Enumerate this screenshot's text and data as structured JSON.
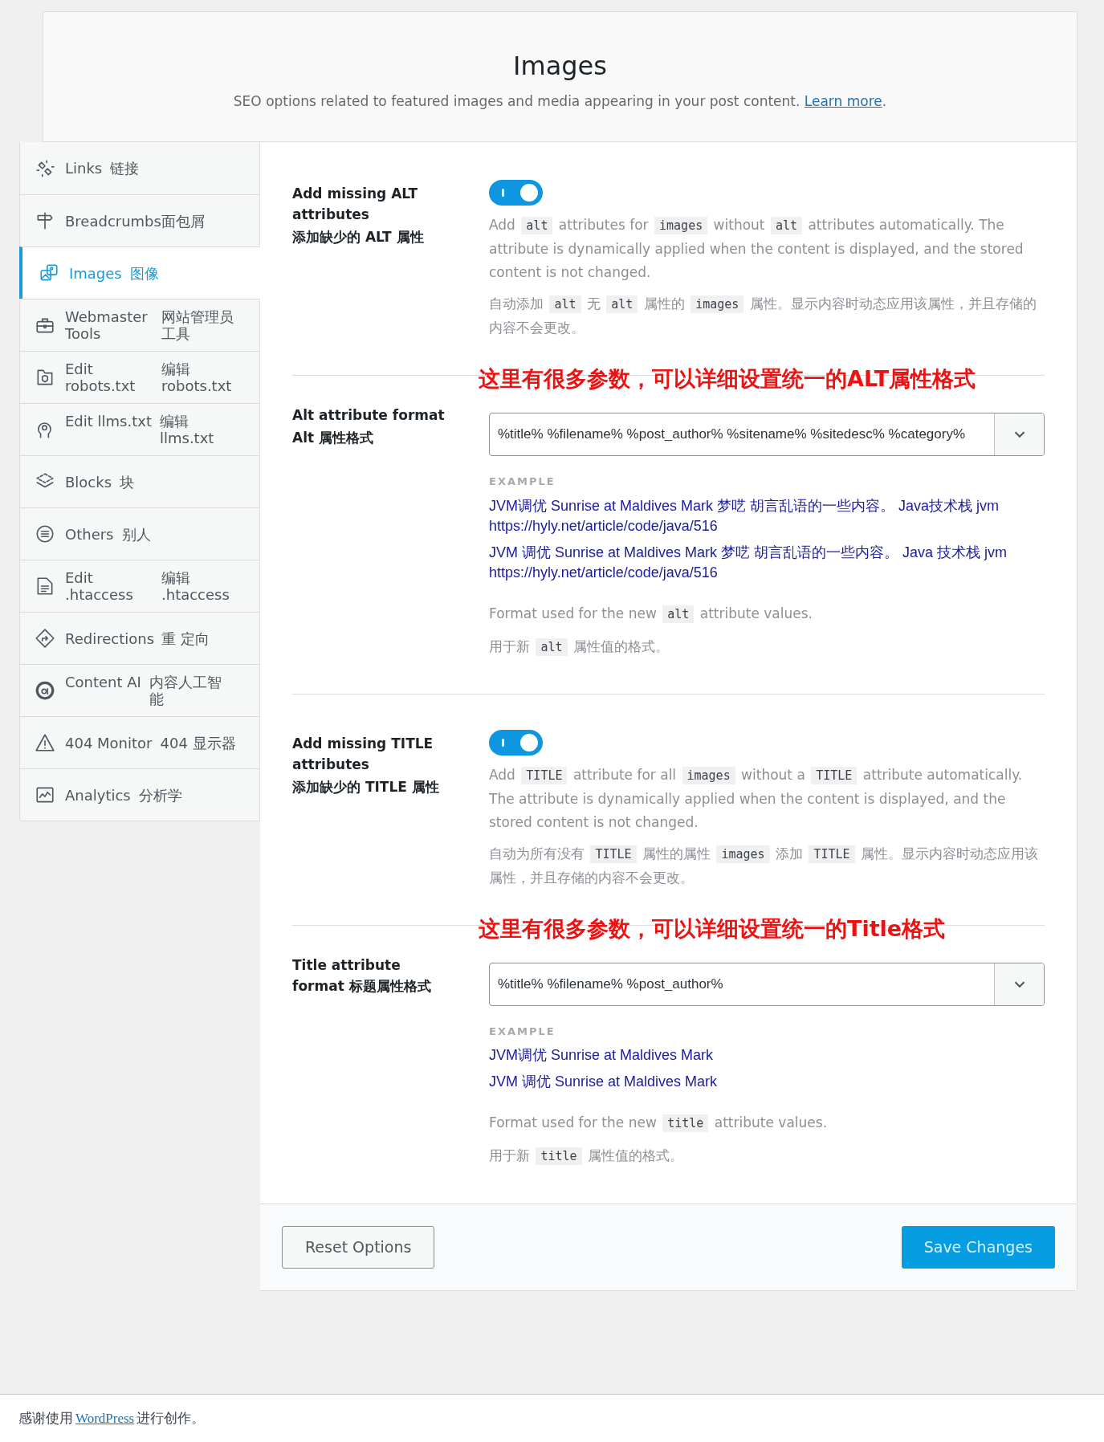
{
  "header": {
    "title": "Images",
    "subtitle": "SEO options related to featured images and media appearing in your post content.",
    "learn_more": "Learn more",
    "after_link": "."
  },
  "sidebar": {
    "items": [
      {
        "label": "Links",
        "label_zh": "链接",
        "selected": false
      },
      {
        "label": "Breadcrumbs",
        "label_zh": "面包屑",
        "selected": false
      },
      {
        "label": "Images",
        "label_zh": "图像",
        "selected": true
      },
      {
        "label": "Webmaster Tools",
        "label_zh": "网站管理员工具",
        "selected": false
      },
      {
        "label": "Edit robots.txt",
        "label_zh": "编辑 robots.txt",
        "selected": false
      },
      {
        "label": "Edit llms.txt",
        "label_zh": "编辑 llms.txt",
        "selected": false
      },
      {
        "label": "Blocks",
        "label_zh": "块",
        "selected": false
      },
      {
        "label": "Others",
        "label_zh": "别人",
        "selected": false
      },
      {
        "label": "Edit .htaccess",
        "label_zh": "编辑 .htaccess",
        "selected": false
      },
      {
        "label": "Redirections",
        "label_zh": "重 定向",
        "selected": false
      },
      {
        "label": "Content AI",
        "label_zh": "内容人工智能",
        "selected": false
      },
      {
        "label": "404 Monitor",
        "label_zh": "404 显示器",
        "selected": false
      },
      {
        "label": "Analytics",
        "label_zh": "分析学",
        "selected": false
      }
    ]
  },
  "fields": [
    {
      "kind": "toggle",
      "label": "Add missing ALT attributes",
      "label_zh": "添加缺少的 ALT 属性",
      "on": true,
      "description": [
        [
          {
            "kind": "text",
            "text": "Add "
          },
          {
            "kind": "code",
            "text": "alt"
          },
          {
            "kind": "text",
            "text": " attributes for "
          },
          {
            "kind": "code",
            "text": "images"
          },
          {
            "kind": "text",
            "text": " without "
          },
          {
            "kind": "code",
            "text": "alt"
          },
          {
            "kind": "text",
            "text": " attributes automatically. The attribute is dynamically applied when the content is displayed, and the stored content is not changed."
          }
        ],
        [
          {
            "kind": "text",
            "text": "自动添加 "
          },
          {
            "kind": "code",
            "text": "alt"
          },
          {
            "kind": "text",
            "text": " 无 "
          },
          {
            "kind": "code",
            "text": "alt"
          },
          {
            "kind": "text",
            "text": " 属性的 "
          },
          {
            "kind": "code",
            "text": "images"
          },
          {
            "kind": "text",
            "text": " 属性。显示内容时动态应用该属性，并且存储的内容不会更改。"
          }
        ]
      ]
    },
    {
      "kind": "select",
      "label": "Alt attribute format",
      "label_zh": "Alt 属性格式",
      "annotation": "这里有很多参数，可以详细设置统一的ALT属性格式",
      "value": "%title% %filename% %post_author% %sitename% %sitedesc% %category%",
      "example_label": "EXAMPLE",
      "examples": [
        "JVM调优 Sunrise at Maldives Mark 梦呓 胡言乱语的一些内容。 Java技术栈 jvm https://hyly.net/article/code/java/516",
        "JVM 调优 Sunrise at Maldives Mark 梦呓 胡言乱语的一些内容。 Java 技术栈 jvm https://hyly.net/article/code/java/516"
      ],
      "description": [
        [
          {
            "kind": "text",
            "text": "Format used for the new "
          },
          {
            "kind": "code",
            "text": "alt"
          },
          {
            "kind": "text",
            "text": " attribute values."
          }
        ],
        [
          {
            "kind": "text",
            "text": "用于新 "
          },
          {
            "kind": "code",
            "text": "alt"
          },
          {
            "kind": "text",
            "text": " 属性值的格式。"
          }
        ]
      ]
    },
    {
      "kind": "toggle",
      "label": "Add missing TITLE attributes",
      "label_zh": "添加缺少的 TITLE 属性",
      "on": true,
      "description": [
        [
          {
            "kind": "text",
            "text": "Add "
          },
          {
            "kind": "code",
            "text": "TITLE"
          },
          {
            "kind": "text",
            "text": " attribute for all "
          },
          {
            "kind": "code",
            "text": "images"
          },
          {
            "kind": "text",
            "text": " without a "
          },
          {
            "kind": "code",
            "text": "TITLE"
          },
          {
            "kind": "text",
            "text": " attribute automatically. The attribute is dynamically applied when the content is displayed, and the stored content is not changed."
          }
        ],
        [
          {
            "kind": "text",
            "text": "自动为所有没有 "
          },
          {
            "kind": "code",
            "text": "TITLE"
          },
          {
            "kind": "text",
            "text": " 属性的属性 "
          },
          {
            "kind": "code",
            "text": "images"
          },
          {
            "kind": "text",
            "text": " 添加 "
          },
          {
            "kind": "code",
            "text": "TITLE"
          },
          {
            "kind": "text",
            "text": " 属性。显示内容时动态应用该属性，并且存储的内容不会更改。"
          }
        ]
      ]
    },
    {
      "kind": "select",
      "label": "Title attribute format",
      "label_zh": "标题属性格式",
      "annotation": "这里有很多参数，可以详细设置统一的Title格式",
      "value": "%title% %filename% %post_author%",
      "example_label": "EXAMPLE",
      "examples": [
        "JVM调优 Sunrise at Maldives Mark",
        "JVM 调优 Sunrise at Maldives Mark"
      ],
      "description": [
        [
          {
            "kind": "text",
            "text": "Format used for the new "
          },
          {
            "kind": "code",
            "text": "title"
          },
          {
            "kind": "text",
            "text": " attribute values."
          }
        ],
        [
          {
            "kind": "text",
            "text": "用于新 "
          },
          {
            "kind": "code",
            "text": "title"
          },
          {
            "kind": "text",
            "text": " 属性值的格式。"
          }
        ]
      ]
    }
  ],
  "buttons": {
    "reset": "Reset Options",
    "save": "Save Changes"
  },
  "footer": {
    "before": "感谢使用",
    "link": "WordPress",
    "after": "进行创作。"
  }
}
